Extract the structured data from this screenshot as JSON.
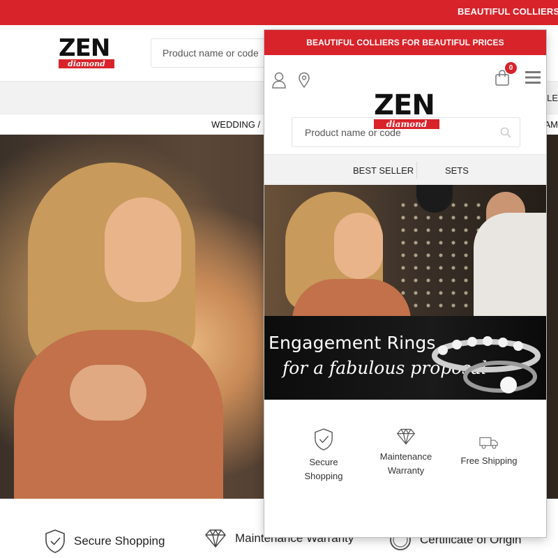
{
  "desktop": {
    "topbar_text": "BEAUTIFUL COLLIERS FO",
    "logo": {
      "word": "ZEN",
      "sub": "diamond"
    },
    "search_placeholder": "Product name or code",
    "menubar_edge_text": "LE",
    "subnav_left": "WEDDING /",
    "subnav_right": "IAM",
    "features": [
      {
        "label": "Secure Shopping",
        "icon": "shield-check-icon"
      },
      {
        "label": "Maintenance Warranty",
        "icon": "diamond-icon"
      },
      {
        "label": "Certificate of Origin",
        "icon": "badge-icon"
      }
    ]
  },
  "mobile": {
    "topbar_text": "BEAUTIFUL COLLIERS FOR BEAUTIFUL PRICES",
    "logo": {
      "word": "ZEN",
      "sub": "diamond"
    },
    "cart_count": "0",
    "search_placeholder": "Product name or code",
    "nav": [
      "BEST SELLER",
      "SETS"
    ],
    "hero": {
      "line1": "Engagement Rings",
      "line2": "for a fabulous proposal"
    },
    "features": [
      {
        "line1": "Secure",
        "line2": "Shopping",
        "icon": "shield-check-icon"
      },
      {
        "line1": "Maintenance",
        "line2": "Warranty",
        "icon": "diamond-icon"
      },
      {
        "line1": "Free Shipping",
        "line2": "",
        "icon": "truck-icon"
      }
    ]
  },
  "colors": {
    "brand_red": "#d8232a",
    "nav_bg": "#f2f2f2",
    "text_dark": "#222222"
  }
}
